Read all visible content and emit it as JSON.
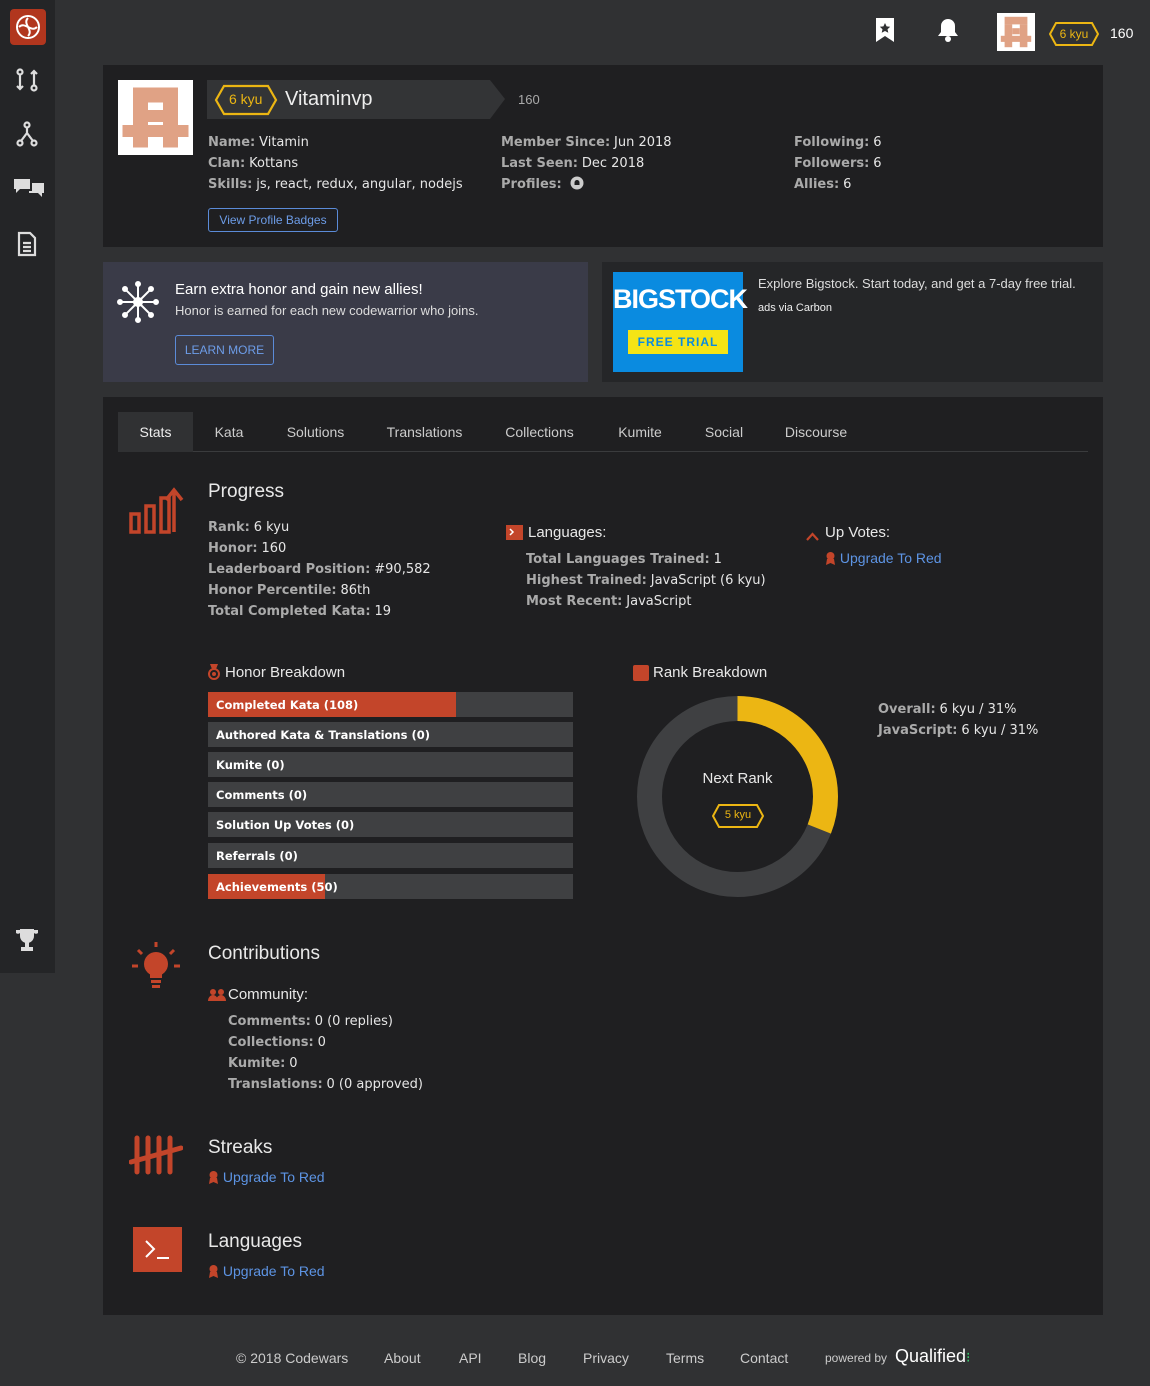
{
  "topbar": {
    "rank": "6 kyu",
    "honor": "160"
  },
  "profile": {
    "rank": "6 kyu",
    "username": "Vitaminvp",
    "honor": "160",
    "name": "Vitamin",
    "clan": "Kottans",
    "skills": "js, react, redux, angular, nodejs",
    "member_since": "Jun 2018",
    "last_seen": "Dec 2018",
    "following": "6",
    "followers": "6",
    "allies": "6",
    "labels": {
      "name": "Name:",
      "clan": "Clan:",
      "skills": "Skills:",
      "member_since": "Member Since:",
      "last_seen": "Last Seen:",
      "profiles": "Profiles:",
      "following": "Following:",
      "followers": "Followers:",
      "allies": "Allies:"
    },
    "badges_button": "View Profile Badges"
  },
  "promo": {
    "title": "Earn extra honor and gain new allies!",
    "subtitle": "Honor is earned for each new codewarrior who joins.",
    "button": "LEARN MORE"
  },
  "ad": {
    "logo": "BIGSTOCK",
    "trial": "FREE TRIAL",
    "text": "Explore Bigstock. Start today, and get a 7-day free trial.",
    "via": "ads via Carbon"
  },
  "tabs": [
    "Stats",
    "Kata",
    "Solutions",
    "Translations",
    "Collections",
    "Kumite",
    "Social",
    "Discourse"
  ],
  "progress": {
    "title": "Progress",
    "labels": {
      "rank": "Rank:",
      "honor": "Honor:",
      "leaderboard": "Leaderboard Position:",
      "percentile": "Honor Percentile:",
      "completed": "Total Completed Kata:"
    },
    "rank": "6 kyu",
    "honor": "160",
    "leaderboard": "#90,582",
    "percentile": "86th",
    "completed": "19"
  },
  "languages_block": {
    "title": "Languages:",
    "labels": {
      "total": "Total Languages Trained:",
      "highest": "Highest Trained:",
      "recent": "Most Recent:"
    },
    "total": "1",
    "highest": "JavaScript (6 kyu)",
    "recent": "JavaScript"
  },
  "upvotes": {
    "title": "Up Votes:",
    "link": "Upgrade To Red"
  },
  "honor_breakdown": {
    "title": "Honor Breakdown",
    "bars": [
      {
        "label": "Completed Kata (108)",
        "fill": 0.68
      },
      {
        "label": "Authored Kata & Translations (0)",
        "fill": 0
      },
      {
        "label": "Kumite (0)",
        "fill": 0
      },
      {
        "label": "Comments (0)",
        "fill": 0
      },
      {
        "label": "Solution Up Votes (0)",
        "fill": 0
      },
      {
        "label": "Referrals (0)",
        "fill": 0
      },
      {
        "label": "Achievements (50)",
        "fill": 0.32
      }
    ]
  },
  "rank_breakdown": {
    "title": "Rank Breakdown",
    "next_rank": "Next Rank",
    "next_kyu": "5 kyu",
    "progress": 0.31,
    "labels": {
      "overall": "Overall:",
      "javascript": "JavaScript:"
    },
    "overall": "6 kyu / 31%",
    "javascript": "6 kyu / 31%"
  },
  "contributions": {
    "title": "Contributions",
    "community": "Community:",
    "labels": {
      "comments": "Comments:",
      "collections": "Collections:",
      "kumite": "Kumite:",
      "translations": "Translations:"
    },
    "comments": "0 (0 replies)",
    "collections": "0",
    "kumite": "0",
    "translations": "0 (0 approved)"
  },
  "streaks": {
    "title": "Streaks",
    "link": "Upgrade To Red"
  },
  "languages": {
    "title": "Languages",
    "link": "Upgrade To Red"
  },
  "footer": {
    "copyright": "© 2018 Codewars",
    "links": [
      "About",
      "API",
      "Blog",
      "Privacy",
      "Terms",
      "Contact"
    ],
    "powered": "powered by",
    "brand": "Qualified"
  },
  "colors": {
    "accent": "#c3452a",
    "rank_yellow": "#ecb613",
    "link": "#5d94e4"
  }
}
